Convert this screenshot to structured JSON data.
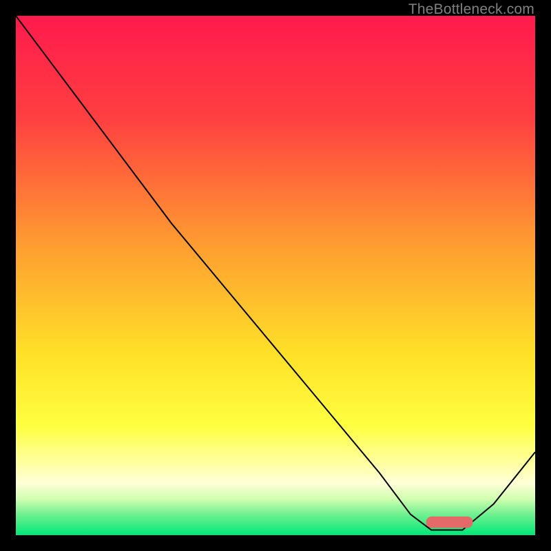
{
  "watermark": "TheBottleneck.com",
  "chart_data": {
    "type": "line",
    "title": "",
    "xlabel": "",
    "ylabel": "",
    "xlim": [
      0,
      100
    ],
    "ylim": [
      0,
      100
    ],
    "background_gradient": {
      "stops": [
        {
          "offset": 0,
          "color": "#ff1a4d"
        },
        {
          "offset": 20,
          "color": "#ff4040"
        },
        {
          "offset": 45,
          "color": "#ffa030"
        },
        {
          "offset": 65,
          "color": "#ffe028"
        },
        {
          "offset": 79,
          "color": "#ffff40"
        },
        {
          "offset": 86,
          "color": "#ffffa0"
        },
        {
          "offset": 90,
          "color": "#ffffd8"
        },
        {
          "offset": 93,
          "color": "#d0ffb0"
        },
        {
          "offset": 96,
          "color": "#70f090"
        },
        {
          "offset": 100,
          "color": "#00e878"
        }
      ]
    },
    "series": [
      {
        "name": "bottleneck-curve",
        "color": "#000000",
        "width": 2,
        "x": [
          0,
          6,
          12,
          18,
          24,
          30,
          40,
          50,
          60,
          70,
          76,
          80,
          86,
          92,
          100
        ],
        "y": [
          100,
          92,
          84,
          76,
          68,
          60,
          48,
          36,
          24,
          12,
          4,
          1,
          1,
          6,
          16
        ]
      }
    ],
    "marker": {
      "name": "optimal-range",
      "color": "#e46a6a",
      "x_start": 79,
      "x_end": 88,
      "y": 2.5,
      "thickness": 2.2
    }
  }
}
